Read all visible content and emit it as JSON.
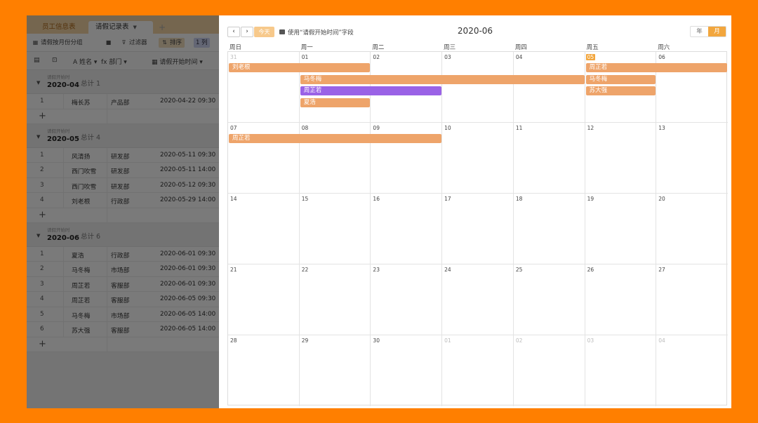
{
  "left": {
    "tabs": [
      "员工信息表",
      "请假记录表"
    ],
    "add_tab": "+",
    "toolbar": {
      "group_label": "请假按月份分组",
      "filter_label": "过滤器",
      "sort_label": "排序",
      "badge_label": "1 列"
    },
    "columns": [
      "姓名",
      "部门",
      "请假开始时间"
    ],
    "groups": [
      {
        "field": "请假开始时",
        "value": "2020-04",
        "count": "总计 1",
        "rows": [
          [
            "1",
            "梅长苏",
            "产品部",
            "2020-04-22 09:30"
          ]
        ]
      },
      {
        "field": "请假开始时",
        "value": "2020-05",
        "count": "总计 4",
        "rows": [
          [
            "1",
            "风清扬",
            "研发部",
            "2020-05-11 09:30"
          ],
          [
            "2",
            "西门吹雪",
            "研发部",
            "2020-05-11 14:00"
          ],
          [
            "3",
            "西门吹雪",
            "研发部",
            "2020-05-12 09:30"
          ],
          [
            "4",
            "刘老根",
            "行政部",
            "2020-05-29 14:00"
          ]
        ]
      },
      {
        "field": "请假开始时",
        "value": "2020-06",
        "count": "总计 6",
        "rows": [
          [
            "1",
            "夏浩",
            "行政部",
            "2020-06-01 09:30"
          ],
          [
            "2",
            "马冬梅",
            "市场部",
            "2020-06-01 09:30"
          ],
          [
            "3",
            "周芷若",
            "客服部",
            "2020-06-01 09:30"
          ],
          [
            "4",
            "周芷若",
            "客服部",
            "2020-06-05 09:30"
          ],
          [
            "5",
            "马冬梅",
            "市场部",
            "2020-06-05 14:00"
          ],
          [
            "6",
            "苏大强",
            "客服部",
            "2020-06-05 14:00"
          ]
        ]
      }
    ],
    "add_row": "+"
  },
  "calendar": {
    "prev": "‹",
    "next": "›",
    "today": "今天",
    "field_text": "使用“请假开始时间”字段",
    "title": "2020-06",
    "views": [
      "年",
      "月"
    ],
    "weekdays": [
      "周日",
      "周一",
      "周二",
      "周三",
      "周四",
      "周五",
      "周六"
    ],
    "weeks": [
      [
        "31",
        "01",
        "02",
        "03",
        "04",
        "05",
        "06"
      ],
      [
        "07",
        "08",
        "09",
        "10",
        "11",
        "12",
        "13"
      ],
      [
        "14",
        "15",
        "16",
        "17",
        "18",
        "19",
        "20"
      ],
      [
        "21",
        "22",
        "23",
        "24",
        "25",
        "26",
        "27"
      ],
      [
        "28",
        "29",
        "30",
        "01",
        "02",
        "03",
        "04"
      ]
    ],
    "other_month": [
      [
        0,
        0
      ],
      [
        4,
        3
      ],
      [
        4,
        4
      ],
      [
        4,
        5
      ],
      [
        4,
        6
      ]
    ],
    "today_cell": [
      0,
      5
    ],
    "colors": {
      "orange": "#eea46a",
      "purple": "#9a62e6",
      "accent": "#f2a63d"
    },
    "events": [
      {
        "label": "刘老根",
        "week": 0,
        "start": 0,
        "span": 2,
        "lane": 0,
        "color": "orange"
      },
      {
        "label": "周芷若",
        "week": 0,
        "start": 5,
        "span": 2,
        "lane": 0,
        "color": "orange"
      },
      {
        "label": "马冬梅",
        "week": 0,
        "start": 1,
        "span": 4,
        "lane": 1,
        "color": "orange"
      },
      {
        "label": "马冬梅",
        "week": 0,
        "start": 5,
        "span": 1,
        "lane": 1,
        "color": "orange"
      },
      {
        "label": "周芷若",
        "week": 0,
        "start": 1,
        "span": 2,
        "lane": 2,
        "color": "purple"
      },
      {
        "label": "苏大强",
        "week": 0,
        "start": 5,
        "span": 1,
        "lane": 2,
        "color": "orange"
      },
      {
        "label": "夏浩",
        "week": 0,
        "start": 1,
        "span": 1,
        "lane": 3,
        "color": "orange"
      },
      {
        "label": "周芷若",
        "week": 1,
        "start": 0,
        "span": 3,
        "lane": 0,
        "color": "orange"
      }
    ]
  }
}
